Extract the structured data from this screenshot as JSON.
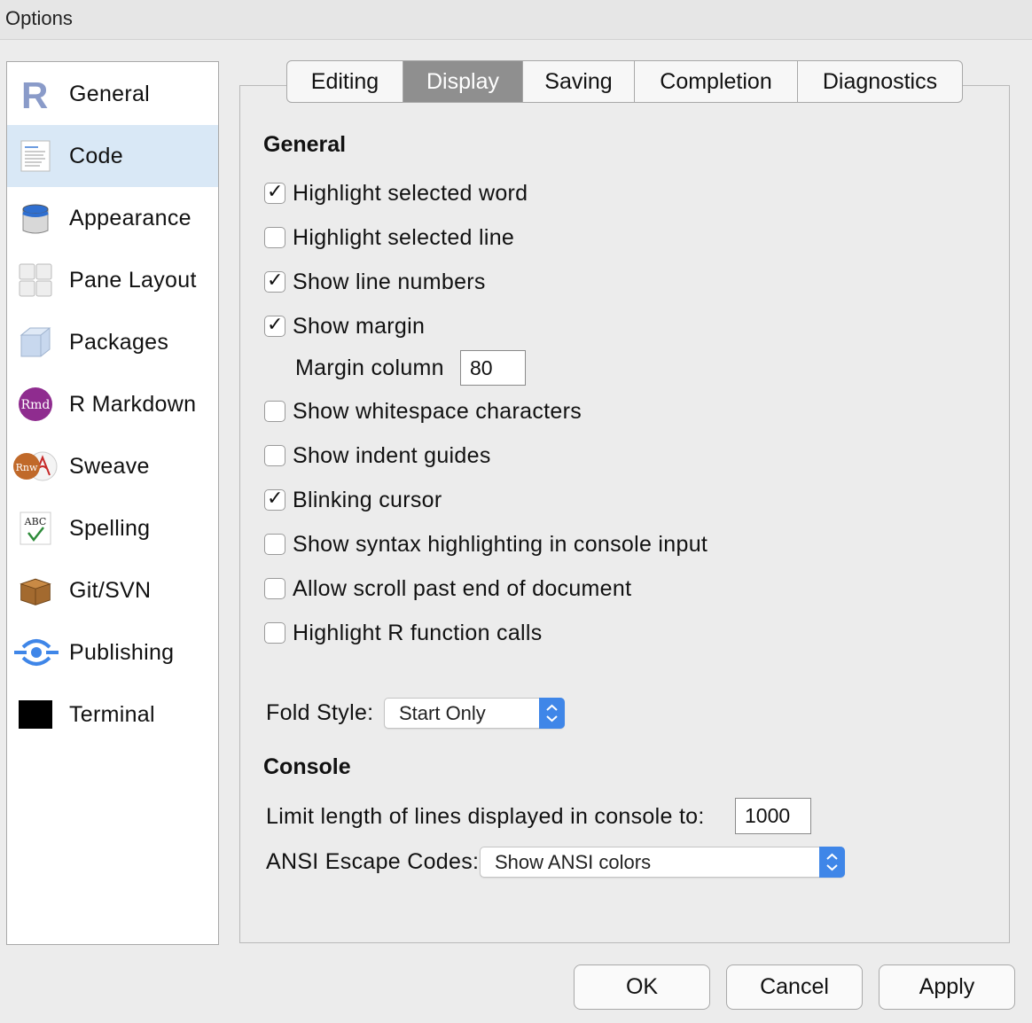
{
  "window": {
    "title": "Options"
  },
  "sidebar": {
    "items": [
      {
        "label": "General",
        "icon": "r-logo-icon"
      },
      {
        "label": "Code",
        "icon": "code-document-icon",
        "selected": true
      },
      {
        "label": "Appearance",
        "icon": "paint-bucket-icon"
      },
      {
        "label": "Pane Layout",
        "icon": "pane-grid-icon"
      },
      {
        "label": "Packages",
        "icon": "package-cube-icon"
      },
      {
        "label": "R Markdown",
        "icon": "rmd-icon"
      },
      {
        "label": "Sweave",
        "icon": "sweave-pdf-icon"
      },
      {
        "label": "Spelling",
        "icon": "abc-check-icon"
      },
      {
        "label": "Git/SVN",
        "icon": "cardboard-box-icon"
      },
      {
        "label": "Publishing",
        "icon": "publish-icon"
      },
      {
        "label": "Terminal",
        "icon": "terminal-icon"
      }
    ]
  },
  "tabs": [
    {
      "label": "Editing"
    },
    {
      "label": "Display",
      "active": true
    },
    {
      "label": "Saving"
    },
    {
      "label": "Completion"
    },
    {
      "label": "Diagnostics"
    }
  ],
  "general": {
    "title": "General",
    "checkboxes": [
      {
        "label": "Highlight selected word",
        "checked": true
      },
      {
        "label": "Highlight selected line",
        "checked": false
      },
      {
        "label": "Show line numbers",
        "checked": true
      },
      {
        "label": "Show margin",
        "checked": true
      },
      {
        "label": "Show whitespace characters",
        "checked": false
      },
      {
        "label": "Show indent guides",
        "checked": false
      },
      {
        "label": "Blinking cursor",
        "checked": true
      },
      {
        "label": "Show syntax highlighting in console input",
        "checked": false
      },
      {
        "label": "Allow scroll past end of document",
        "checked": false
      },
      {
        "label": "Highlight R function calls",
        "checked": false
      }
    ],
    "margin_column_label": "Margin column",
    "margin_column_value": "80",
    "fold_style_label": "Fold Style:",
    "fold_style_value": "Start Only"
  },
  "console": {
    "title": "Console",
    "limit_label": "Limit length of lines displayed in console to:",
    "limit_value": "1000",
    "ansi_label": "ANSI Escape Codes:",
    "ansi_value": "Show ANSI colors"
  },
  "buttons": {
    "ok": "OK",
    "cancel": "Cancel",
    "apply": "Apply"
  },
  "colors": {
    "accent": "#3f86e8",
    "selected_bg": "#d9e8f6",
    "active_tab": "#8f8f8f"
  }
}
